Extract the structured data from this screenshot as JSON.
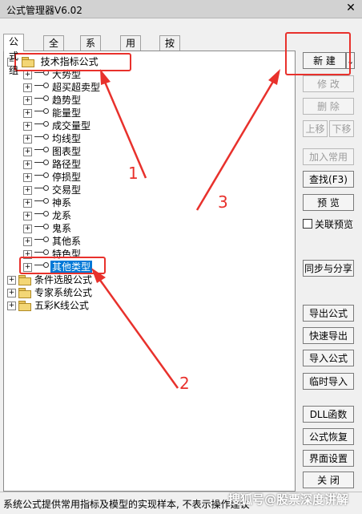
{
  "window": {
    "title": "公式管理器V6.02",
    "close": "✕"
  },
  "tabs": [
    {
      "label": "公式组",
      "active": true
    },
    {
      "label": "全部",
      "active": false
    },
    {
      "label": "系统",
      "active": false
    },
    {
      "label": "用户",
      "active": false
    },
    {
      "label": "按日期频度",
      "active": false
    }
  ],
  "tree": {
    "root": {
      "label": "技术指标公式",
      "expander": "−"
    },
    "children": [
      {
        "label": "大势型"
      },
      {
        "label": "超买超卖型"
      },
      {
        "label": "趋势型"
      },
      {
        "label": "能量型"
      },
      {
        "label": "成交量型"
      },
      {
        "label": "均线型"
      },
      {
        "label": "图表型"
      },
      {
        "label": "路径型"
      },
      {
        "label": "停损型"
      },
      {
        "label": "交易型"
      },
      {
        "label": "神系"
      },
      {
        "label": "龙系"
      },
      {
        "label": "鬼系"
      },
      {
        "label": "其他系"
      },
      {
        "label": "特色型"
      },
      {
        "label": "其他类型",
        "selected": true
      }
    ],
    "others": [
      {
        "label": "条件选股公式"
      },
      {
        "label": "专家系统公式"
      },
      {
        "label": "五彩K线公式"
      }
    ],
    "expand_plus": "+"
  },
  "buttons": {
    "new": "新 建",
    "new_arrow": "↓",
    "edit": "修 改",
    "delete": "删 除",
    "up": "上移",
    "down": "下移",
    "add_common": "加入常用",
    "find": "查找(F3)",
    "preview": "预 览",
    "linked_preview": "关联预览",
    "sync_share": "同步与分享",
    "export": "导出公式",
    "quick_export": "快速导出",
    "import": "导入公式",
    "temp_import": "临时导入",
    "dll": "DLL函数",
    "restore": "公式恢复",
    "interface": "界面设置",
    "close": "关 闭"
  },
  "status": {
    "text": "系统公式提供常用指标及模型的实现样本, 不表示操作建议"
  },
  "watermark": "搜狐号@股票深度讲解",
  "annotations": {
    "one": "1",
    "two": "2",
    "three": "3",
    "color": "#e8312c"
  }
}
